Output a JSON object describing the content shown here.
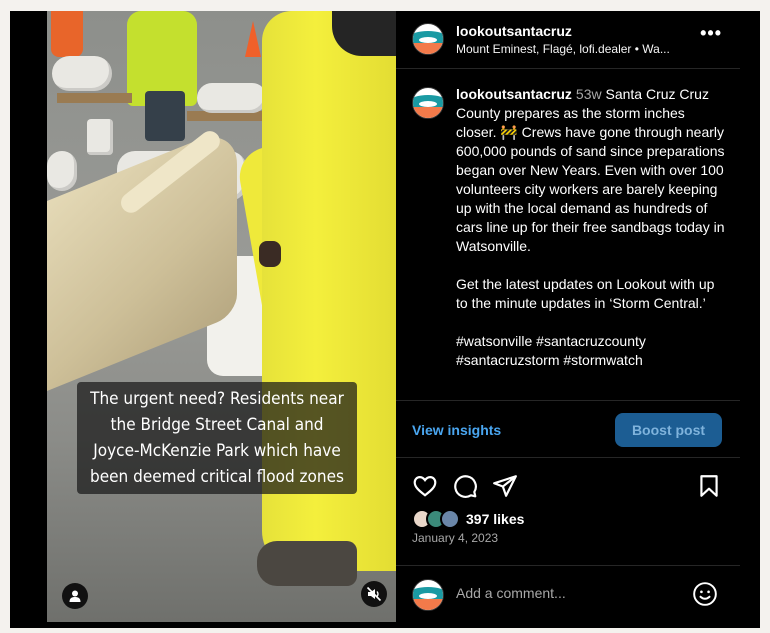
{
  "media": {
    "caption": "The urgent need? Residents near the Bridge Street Canal and Joyce-McKenzie Park which have been deemed critical flood zones"
  },
  "post": {
    "username": "lookoutsantacruz",
    "header_subtitle": "Mount Eminest, Flagé, lofi.dealer • Wa...",
    "time_ago": "53w",
    "caption_p1": "Santa Cruz Cruz County prepares as the storm inches closer. 🚧 Crews have gone through nearly 600,000 pounds of sand since preparations began over New Years. Even with over 100 volunteers city workers are barely keeping up with the local demand as hundreds of cars line up for their free sandbags today in Watsonville.",
    "caption_p2": "Get the latest updates on Lookout with up to the minute updates in ‘Storm Central.’",
    "hashtags": "#watsonville #santacruzcounty #santacruzstorm #stormwatch",
    "view_insights_label": "View insights",
    "boost_label": "Boost post",
    "likes": "397 likes",
    "date": "January 4, 2023",
    "comment_placeholder": "Add a comment..."
  },
  "colors": {
    "link_blue": "#4aa6f0",
    "boost_bg": "#1c5d93",
    "boost_text": "#7fb3dc",
    "background": "#000000"
  },
  "icons": {
    "more": "more-dots-icon",
    "like": "heart-icon",
    "comment": "comment-bubble-icon",
    "share": "paper-plane-icon",
    "save": "bookmark-icon",
    "emoji": "smiley-icon",
    "user": "user-tag-icon",
    "mute": "muted-speaker-icon"
  }
}
